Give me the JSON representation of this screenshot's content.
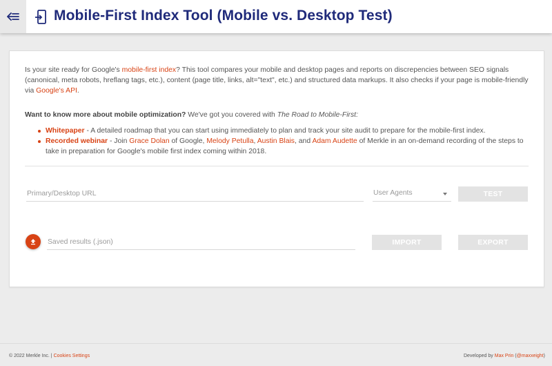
{
  "header": {
    "title": "Mobile-First Index Tool (Mobile vs. Desktop Test)",
    "menu_icon": "back-arrow-menu-icon",
    "title_icon": "mobile-device-arrow-icon"
  },
  "intro": {
    "p1_before": "Is your site ready for Google's ",
    "p1_link": "mobile-first index",
    "p1_after": "? This tool compares your mobile and desktop pages and reports on discrepencies between SEO signals (canonical, meta robots, hreflang tags, etc.), content (page title, links, alt=\"text\", etc.) and structured data markups. It also checks if your page is mobile-friendly via ",
    "p1_link2": "Google's API",
    "p1_end": "."
  },
  "more": {
    "bold": "Want to know more about mobile optimization?",
    "text": " We've got you covered with ",
    "italic": "The Road to Mobile-First:"
  },
  "bullets": {
    "whitepaper_title": "Whitepaper",
    "whitepaper_text": " - A detailed roadmap that you can start using immediately to plan and track your site audit to prepare for the mobile-first index.",
    "webinar_title": "Recorded webinar",
    "webinar_t1": " - Join ",
    "person1": "Grace Dolan",
    "webinar_t2": " of Google, ",
    "person2": "Melody Petulla",
    "webinar_t3": ", ",
    "person3": "Austin Blais",
    "webinar_t4": ", and ",
    "person4": "Adam Audette",
    "webinar_t5": " of Merkle in an on-demand recording of the steps to take in preparation for Google's mobile first index coming within 2018."
  },
  "form": {
    "url_placeholder": "Primary/Desktop URL",
    "url_value": "",
    "user_agents_label": "User Agents",
    "test_label": "TEST",
    "json_placeholder": "Saved results (.json)",
    "json_value": "",
    "import_label": "IMPORT",
    "export_label": "EXPORT",
    "upload_icon": "upload-icon"
  },
  "footer": {
    "copyright": "© 2022 Merkle Inc. | ",
    "cookies": "Cookies Settings",
    "dev_prefix": "Developed by ",
    "dev_name": "Max Prin",
    "dev_handle_open": " (",
    "dev_handle": "@maxxeight",
    "dev_handle_close": ")"
  },
  "colors": {
    "accent": "#d84315",
    "title": "#1f2a7a",
    "button_disabled": "#e3e3e3",
    "background": "#ececec"
  }
}
